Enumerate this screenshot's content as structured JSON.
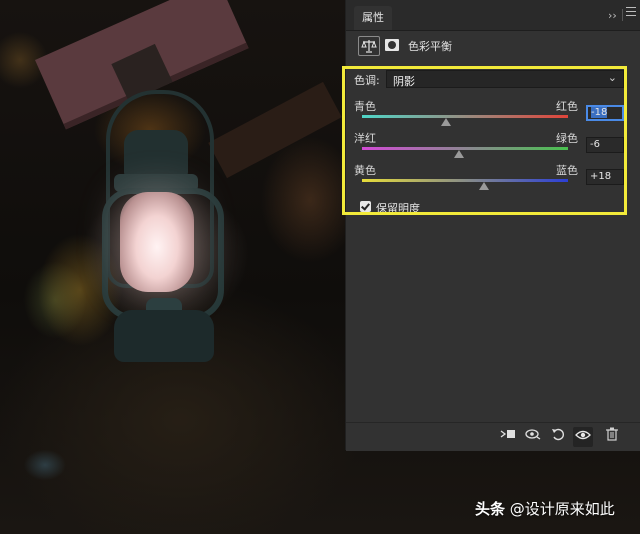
{
  "panel": {
    "tab_label": "属性",
    "collapse_glyph": "››",
    "title": "色彩平衡",
    "tone": {
      "label": "色调:",
      "value": "阴影"
    },
    "sliders": [
      {
        "left_label": "青色",
        "right_label": "红色",
        "value": "-18",
        "level": -18,
        "color_left": "#4fd6c8",
        "color_right": "#e0443a"
      },
      {
        "left_label": "洋红",
        "right_label": "绿色",
        "value": "-6",
        "level": -6,
        "color_left": "#d24bd6",
        "color_right": "#49c24f"
      },
      {
        "left_label": "黄色",
        "right_label": "蓝色",
        "value": "+18",
        "level": 18,
        "color_left": "#e6dc3a",
        "color_right": "#2c3fd6"
      }
    ],
    "preserve_luminosity": {
      "label": "保留明度",
      "checked": true
    },
    "bottom_icons": [
      "clip-to-layer-icon",
      "view-previous-state-icon",
      "reset-icon",
      "visibility-eye-icon",
      "trash-icon"
    ]
  },
  "watermark": {
    "brand": "头条",
    "handle": "@设计原来如此"
  },
  "highlight_color": "#f2ea3a"
}
